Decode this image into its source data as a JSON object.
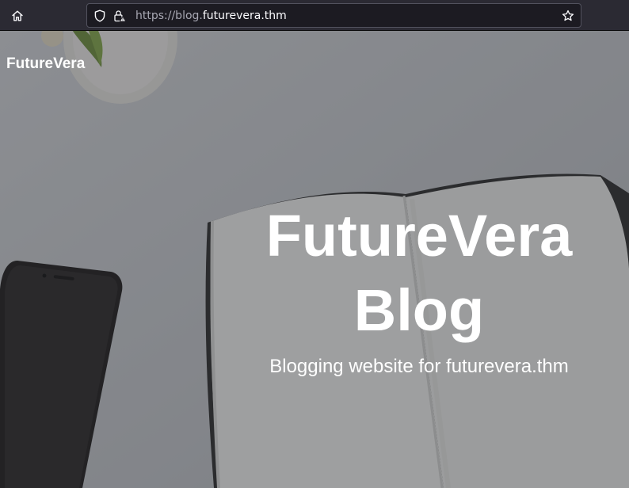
{
  "browser": {
    "url_prefix": "https://blog.",
    "url_domain": "futurevera.thm",
    "icons": [
      "home-icon",
      "shield-icon",
      "lock-warning-icon",
      "star-icon"
    ]
  },
  "site": {
    "logo": "FutureVera",
    "hero_title_line1": "FutureVera",
    "hero_title_line2": "Blog",
    "hero_subtitle": "Blogging website for futurevera.thm"
  },
  "colors": {
    "toolbar": "#2b2a33",
    "urlbar": "#1c1b22",
    "hero_text": "#ffffff"
  }
}
